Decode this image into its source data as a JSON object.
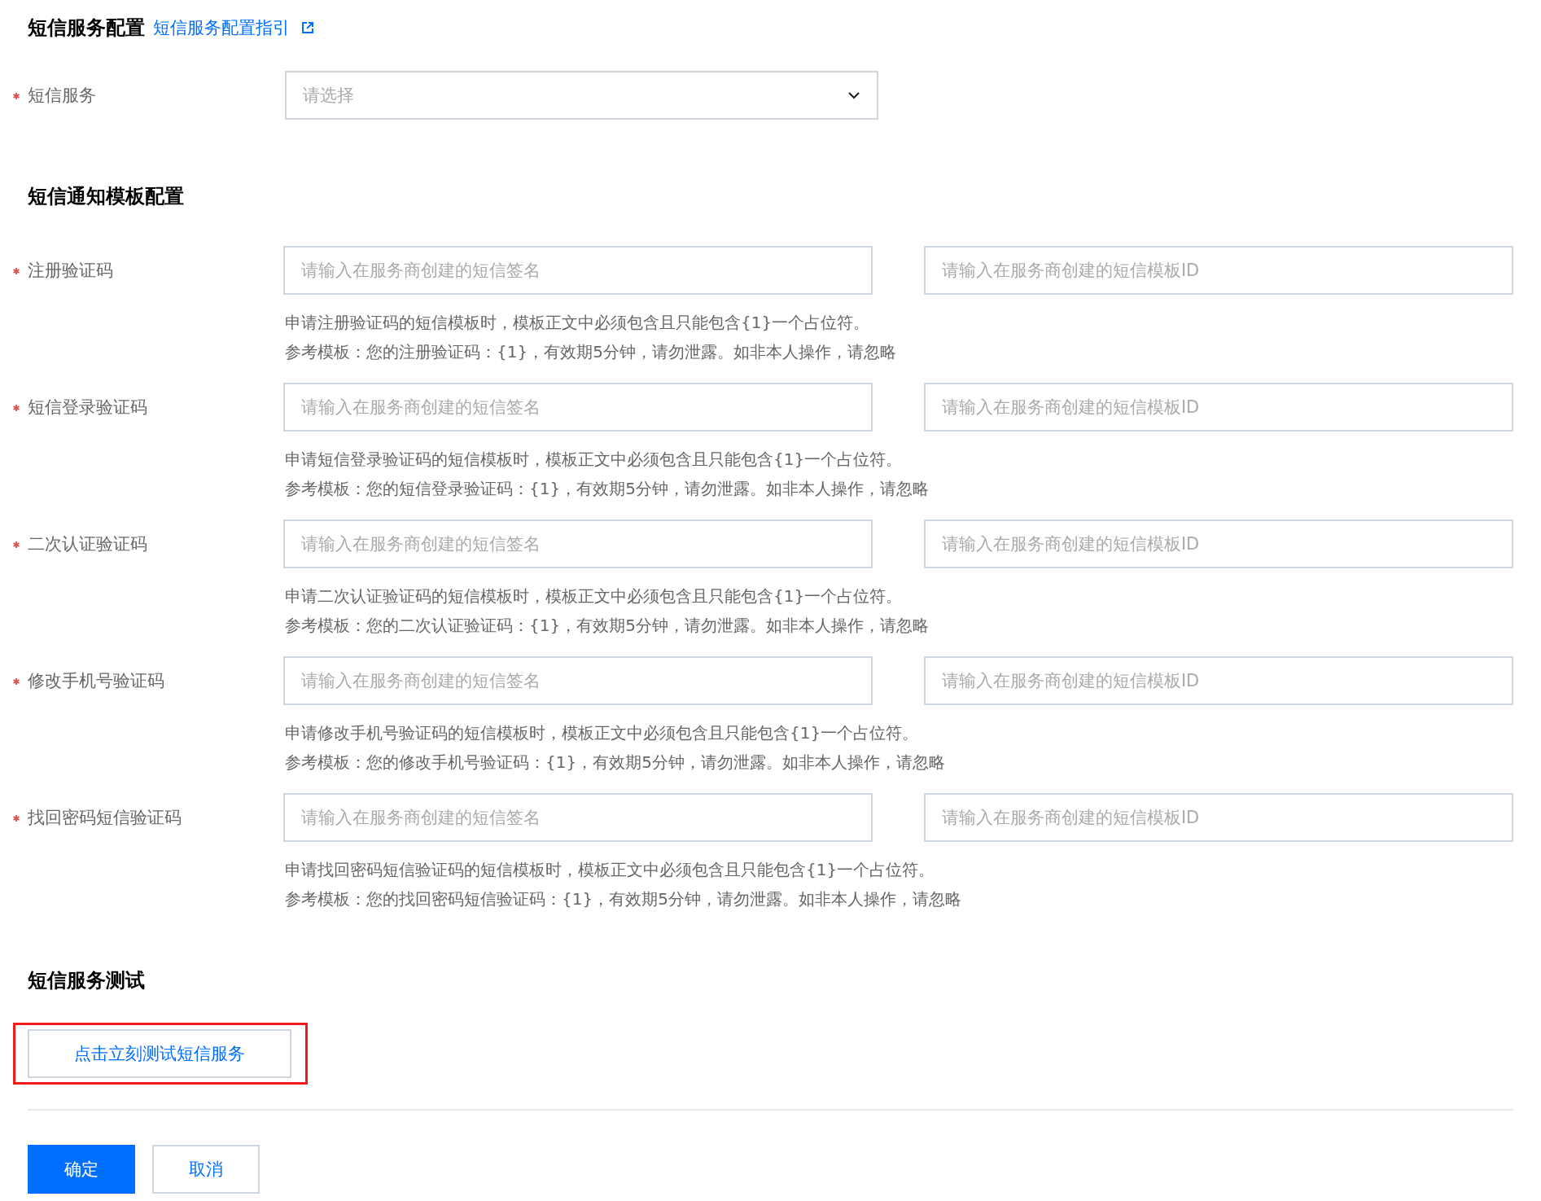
{
  "header": {
    "title": "短信服务配置",
    "guide_link": "短信服务配置指引"
  },
  "sms_service": {
    "label": "短信服务",
    "required": true,
    "placeholder": "请选择"
  },
  "template_section": {
    "title": "短信通知模板配置",
    "rows": [
      {
        "label": "注册验证码",
        "required": true,
        "signature_placeholder": "请输入在服务商创建的短信签名",
        "template_placeholder": "请输入在服务商创建的短信模板ID",
        "hint_lines": [
          "申请注册验证码的短信模板时，模板正文中必须包含且只能包含{1}一个占位符。",
          "参考模板：您的注册验证码：{1}，有效期5分钟，请勿泄露。如非本人操作，请忽略"
        ]
      },
      {
        "label": "短信登录验证码",
        "required": true,
        "signature_placeholder": "请输入在服务商创建的短信签名",
        "template_placeholder": "请输入在服务商创建的短信模板ID",
        "hint_lines": [
          "申请短信登录验证码的短信模板时，模板正文中必须包含且只能包含{1}一个占位符。",
          "参考模板：您的短信登录验证码：{1}，有效期5分钟，请勿泄露。如非本人操作，请忽略"
        ]
      },
      {
        "label": "二次认证验证码",
        "required": true,
        "signature_placeholder": "请输入在服务商创建的短信签名",
        "template_placeholder": "请输入在服务商创建的短信模板ID",
        "hint_lines": [
          "申请二次认证验证码的短信模板时，模板正文中必须包含且只能包含{1}一个占位符。",
          "参考模板：您的二次认证验证码：{1}，有效期5分钟，请勿泄露。如非本人操作，请忽略"
        ]
      },
      {
        "label": "修改手机号验证码",
        "required": true,
        "signature_placeholder": "请输入在服务商创建的短信签名",
        "template_placeholder": "请输入在服务商创建的短信模板ID",
        "hint_lines": [
          "申请修改手机号验证码的短信模板时，模板正文中必须包含且只能包含{1}一个占位符。",
          "参考模板：您的修改手机号验证码：{1}，有效期5分钟，请勿泄露。如非本人操作，请忽略"
        ]
      },
      {
        "label": "找回密码短信验证码",
        "required": true,
        "signature_placeholder": "请输入在服务商创建的短信签名",
        "template_placeholder": "请输入在服务商创建的短信模板ID",
        "hint_lines": [
          "申请找回密码短信验证码的短信模板时，模板正文中必须包含且只能包含{1}一个占位符。",
          "参考模板：您的找回密码短信验证码：{1}，有效期5分钟，请勿泄露。如非本人操作，请忽略"
        ]
      }
    ]
  },
  "test_section": {
    "title": "短信服务测试",
    "test_button": "点击立刻测试短信服务"
  },
  "footer": {
    "buttons": [
      {
        "label": "确定",
        "kind": "primary"
      },
      {
        "label": "取消",
        "kind": "secondary"
      }
    ]
  }
}
